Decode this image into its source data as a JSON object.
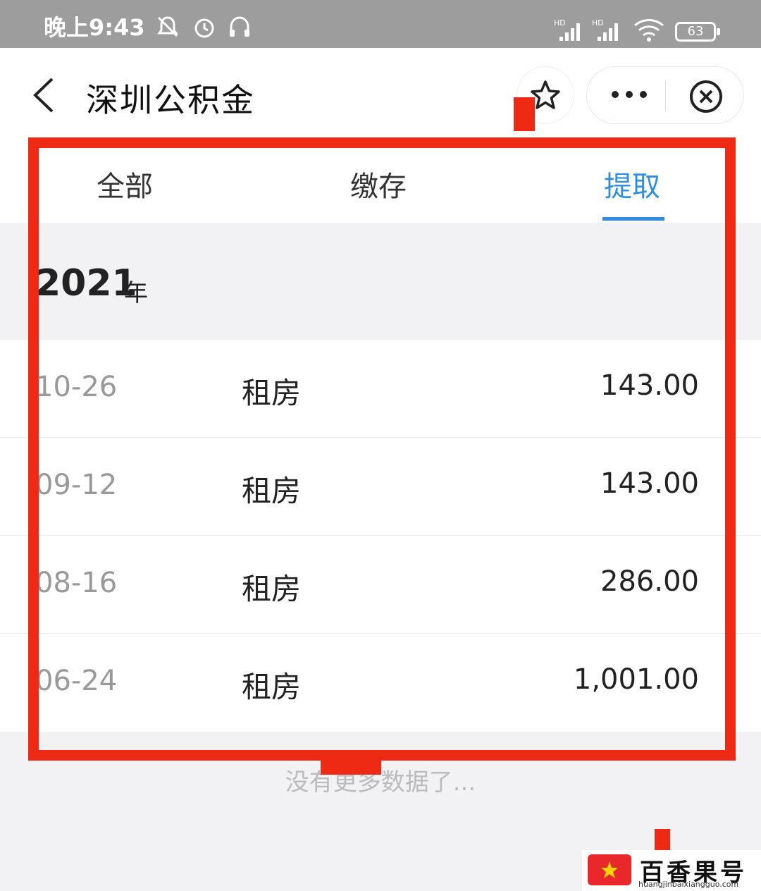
{
  "status_bar": {
    "time": "晚上9:43",
    "battery": "63",
    "icons": [
      "mute-bell-icon",
      "alarm-icon",
      "headset-icon",
      "hd-signal-icon",
      "hd-signal-icon",
      "wifi-icon",
      "battery-icon"
    ]
  },
  "nav": {
    "title": "深圳公积金",
    "back_icon": "chevron-left-icon",
    "favorite_icon": "star-icon",
    "more_icon": "more-dots-icon",
    "close_icon": "close-circle-icon"
  },
  "tabs": [
    {
      "label": "全部",
      "active": false
    },
    {
      "label": "缴存",
      "active": false
    },
    {
      "label": "提取",
      "active": true
    }
  ],
  "year_header": {
    "year": "2021",
    "suffix": "年"
  },
  "records": [
    {
      "date": "10-26",
      "type": "租房",
      "amount": "143.00"
    },
    {
      "date": "09-12",
      "type": "租房",
      "amount": "143.00"
    },
    {
      "date": "08-16",
      "type": "租房",
      "amount": "286.00"
    },
    {
      "date": "06-24",
      "type": "租房",
      "amount": "1,001.00"
    }
  ],
  "footer_note": "没有更多数据了...",
  "watermark": {
    "name": "百香果号",
    "url": "huangjinbaixiangguo.com"
  },
  "colors": {
    "accent": "#2f8de4",
    "highlight_frame": "#ee2a14",
    "status_bar": "#9d9d9d"
  }
}
